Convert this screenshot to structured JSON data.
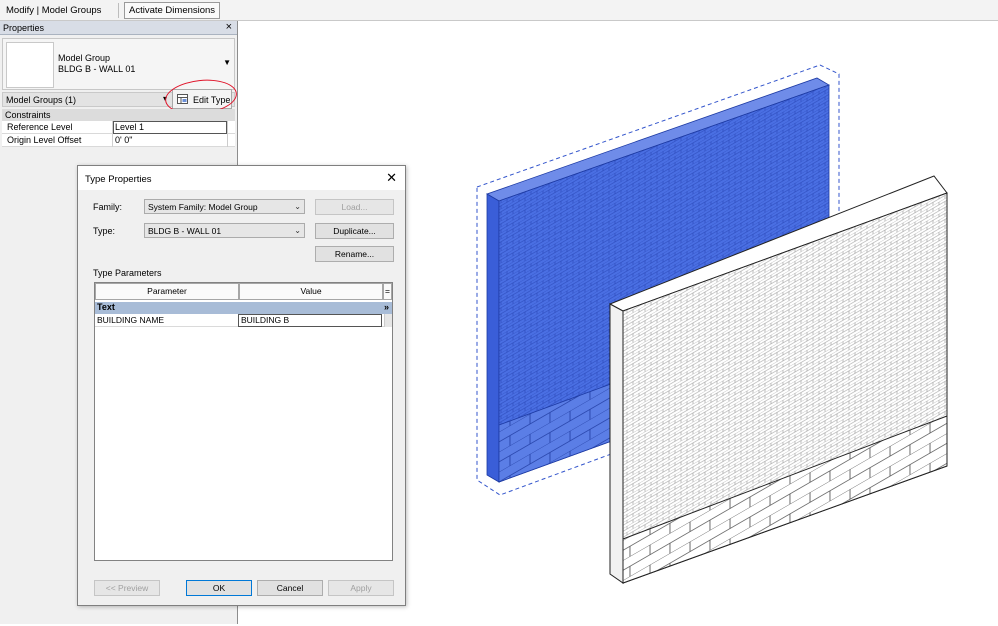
{
  "contextbar": {
    "title": "Modify | Model Groups",
    "activate_dimensions": "Activate Dimensions"
  },
  "properties": {
    "title": "Properties",
    "close": "×",
    "type_line1": "Model Group",
    "type_line2": "BLDG B - WALL 01",
    "filter": "Model Groups (1)",
    "edit_type": "Edit Type",
    "section": "Constraints",
    "rows": [
      {
        "name": "Reference Level",
        "value": "Level 1"
      },
      {
        "name": "Origin Level Offset",
        "value": "0'  0\""
      }
    ]
  },
  "dialog": {
    "title": "Type Properties",
    "close": "✕",
    "family_label": "Family:",
    "family_value": "System Family: Model Group",
    "type_label": "Type:",
    "type_value": "BLDG B - WALL 01",
    "load": "Load...",
    "duplicate": "Duplicate...",
    "rename": "Rename...",
    "type_parameters": "Type Parameters",
    "col_parameter": "Parameter",
    "col_value": "Value",
    "col_eq": "=",
    "section": "Text",
    "section_toggle": "»",
    "rows": [
      {
        "name": "BUILDING NAME",
        "value": "BUILDING B"
      }
    ],
    "preview": "<< Preview",
    "ok": "OK",
    "cancel": "Cancel",
    "apply": "Apply"
  },
  "colors": {
    "selection_blue": "#4a6fe3",
    "annotation_red": "#e0142a",
    "dialog_bg": "#f0f0f0",
    "grid_section": "#a8bcd7"
  }
}
